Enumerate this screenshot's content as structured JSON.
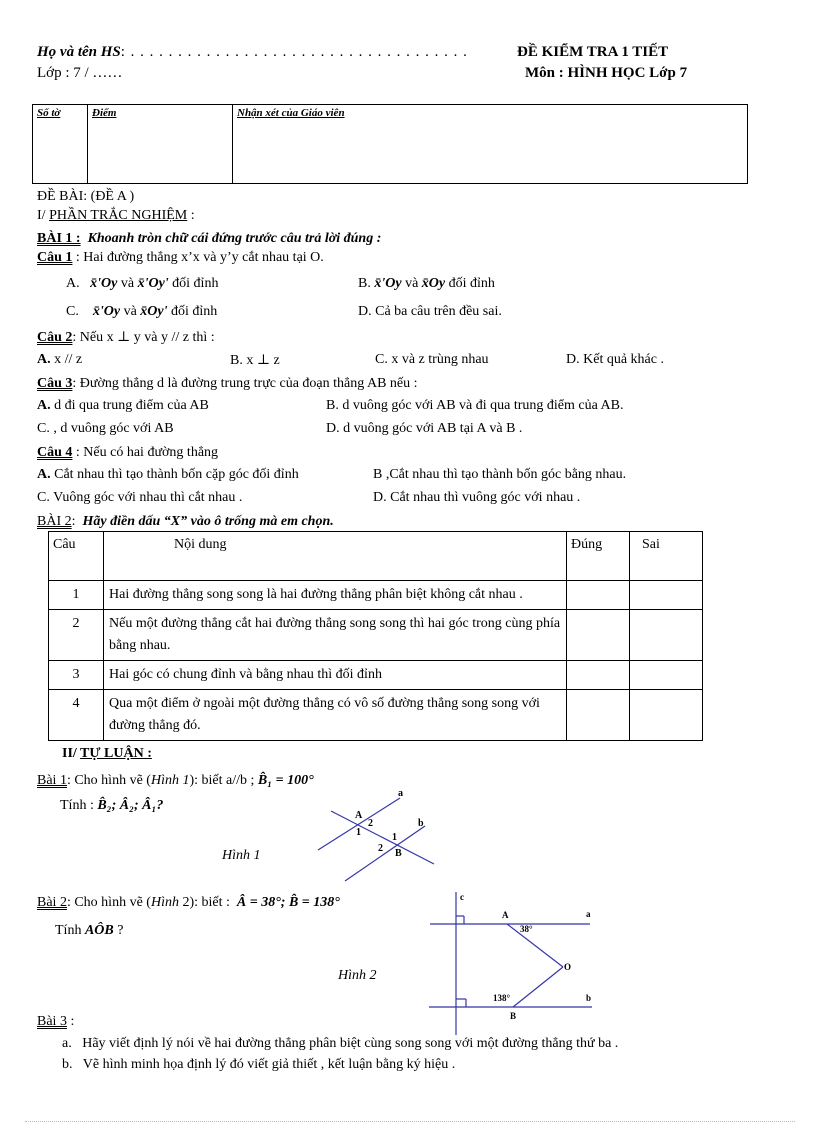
{
  "header": {
    "student_name_label": "Họ và tên HS",
    "student_name_dots": ": . . . . . . . . . . . . . . . . . . . . . . . . . . . . . . . . . . . .",
    "class_label": "Lớp : 7 / ……",
    "exam_title": "ĐỀ KIỂM TRA 1 TIẾT",
    "subject": "Môn : HÌNH HỌC Lớp  7"
  },
  "score_box": {
    "sheet_label": "Số tờ",
    "score_label": "Điểm",
    "comment_label": "Nhận xét của Giáo viên"
  },
  "exam": {
    "heading": "ĐỀ BÀI:   (ĐỀ A )",
    "part1_prefix": "I/ ",
    "part1_title": "PHẦN  TRẮC NGHIỆM",
    "part1_suffix": " :",
    "bai1_label": "BÀI 1 :",
    "bai1_instruction": "Khoanh tròn chữ cái đứng trước câu trả lời đúng :",
    "questions": [
      {
        "label": "Câu 1",
        "text": ": Hai đường thẳng x’x và y’y cắt nhau tại O.",
        "options": [
          {
            "letter": "A.",
            "text_a": "x̄'Oy",
            "mid": " và ",
            "text_b": "x̄'Oy'",
            "tail": " đối đỉnh"
          },
          {
            "letter": "B.",
            "text_a": "x̄'Oy",
            "mid": " và ",
            "text_b": "x̄Oy",
            "tail": " đối đỉnh"
          },
          {
            "letter": "C.",
            "text_a": "x̄'Oy",
            "mid": " và ",
            "text_b": "x̄Oy'",
            "tail": " đối đỉnh"
          },
          {
            "letter": "D.",
            "text": "Cả ba câu trên đều sai."
          }
        ]
      },
      {
        "label": "Câu 2",
        "text": ":  Nếu x  ⊥ y và y // z  thì :",
        "options": [
          {
            "letter": "A.",
            "text": "x // z"
          },
          {
            "letter": "B.",
            "text": "x  ⊥ z"
          },
          {
            "letter": "C.",
            "text": "x  và  z  trùng nhau"
          },
          {
            "letter": "D.",
            "text": "Kết quả khác ."
          }
        ]
      },
      {
        "label": "Câu 3",
        "text": ":  Đường thẳng d là đường trung trực của đoạn thẳng AB nếu :",
        "options": [
          {
            "letter": "A.",
            "text": " d  đi qua trung điểm của AB"
          },
          {
            "letter": "B.",
            "text": " d  vuông góc với AB và đi qua trung điểm của AB."
          },
          {
            "letter": "C.",
            "text": " , d  vuông góc với AB"
          },
          {
            "letter": "D.",
            "text": " d  vuông góc với AB tại A và B ."
          }
        ]
      },
      {
        "label": "Câu 4",
        "text": ": Nếu có hai đường thẳng",
        "options": [
          {
            "letter": "A.",
            "text": " Cắt nhau thì tạo thành bốn cặp góc đối đỉnh"
          },
          {
            "letter": "B",
            "text": " ,Cắt nhau thì tạo thành bốn góc bằng nhau."
          },
          {
            "letter": "C.",
            "text": " Vuông góc với nhau thì cắt nhau ."
          },
          {
            "letter": "D.",
            "text": " Cắt nhau thì vuông góc với nhau ."
          }
        ]
      }
    ],
    "bai2_label": "BÀI 2",
    "bai2_instruction": "Hãy điền dấu “X” vào ô trống mà em chọn.",
    "table": {
      "headers": [
        "Câu",
        "Nội dung",
        "Đúng",
        "Sai"
      ],
      "rows": [
        {
          "num": "1",
          "content": "Hai đường thẳng song song là hai đường thẳng phân biệt không cắt nhau .",
          "correct": "",
          "wrong": ""
        },
        {
          "num": "2",
          "content": "Nếu một đường thẳng cắt hai đường thẳng song song thì hai góc trong cùng phía bằng nhau.",
          "correct": "",
          "wrong": ""
        },
        {
          "num": "3",
          "content": "Hai góc có chung đỉnh và bằng nhau thì đối đỉnh",
          "correct": "",
          "wrong": ""
        },
        {
          "num": "4",
          "content": "Qua một điểm ở ngoài một đường thẳng có vô số  đường thẳng song song với đường thẳng đó.",
          "correct": "",
          "wrong": ""
        }
      ]
    },
    "part2_prefix": "II/ ",
    "part2_title": "TỰ LUẬN :",
    "essay": [
      {
        "label": "Bài 1",
        "text1": ": Cho hình vẽ (",
        "fig_ref": "Hình 1",
        "text2": "): biết a//b ;",
        "given": "B̂₁ = 100°",
        "ask_prefix": "Tính :",
        "ask": "B̂₂; Â₂; Â₁?",
        "figure_caption": "Hình 1",
        "figure_labels": [
          "a",
          "b",
          "A",
          "B",
          "1",
          "2",
          "1",
          "2"
        ]
      },
      {
        "label": "Bài 2",
        "text1": ": Cho hình vẽ (",
        "fig_ref": "Hình",
        "fig_num": " 2",
        "text2": "):  biết :",
        "given": "Â = 38°; B̂ = 138°",
        "ask_prefix": "Tính",
        "ask": "AÔB",
        "ask_suffix": " ?",
        "figure_caption": "Hình 2",
        "figure_labels": [
          "c",
          "A",
          "a",
          "38°",
          "O",
          "138°",
          "b",
          "B"
        ]
      },
      {
        "label": "Bài 3",
        "suffix": " :",
        "items": [
          {
            "letter": "a.",
            "text": "Hãy viết định lý nói về hai đường thẳng  phân biệt cùng song song với một  đường thẳng thứ ba ."
          },
          {
            "letter": "b.",
            "text": "Vẽ hình minh họa định lý đó viết giả thiết , kết luận bằng ký hiệu ."
          }
        ]
      }
    ]
  },
  "figure_color": "#3535a8"
}
